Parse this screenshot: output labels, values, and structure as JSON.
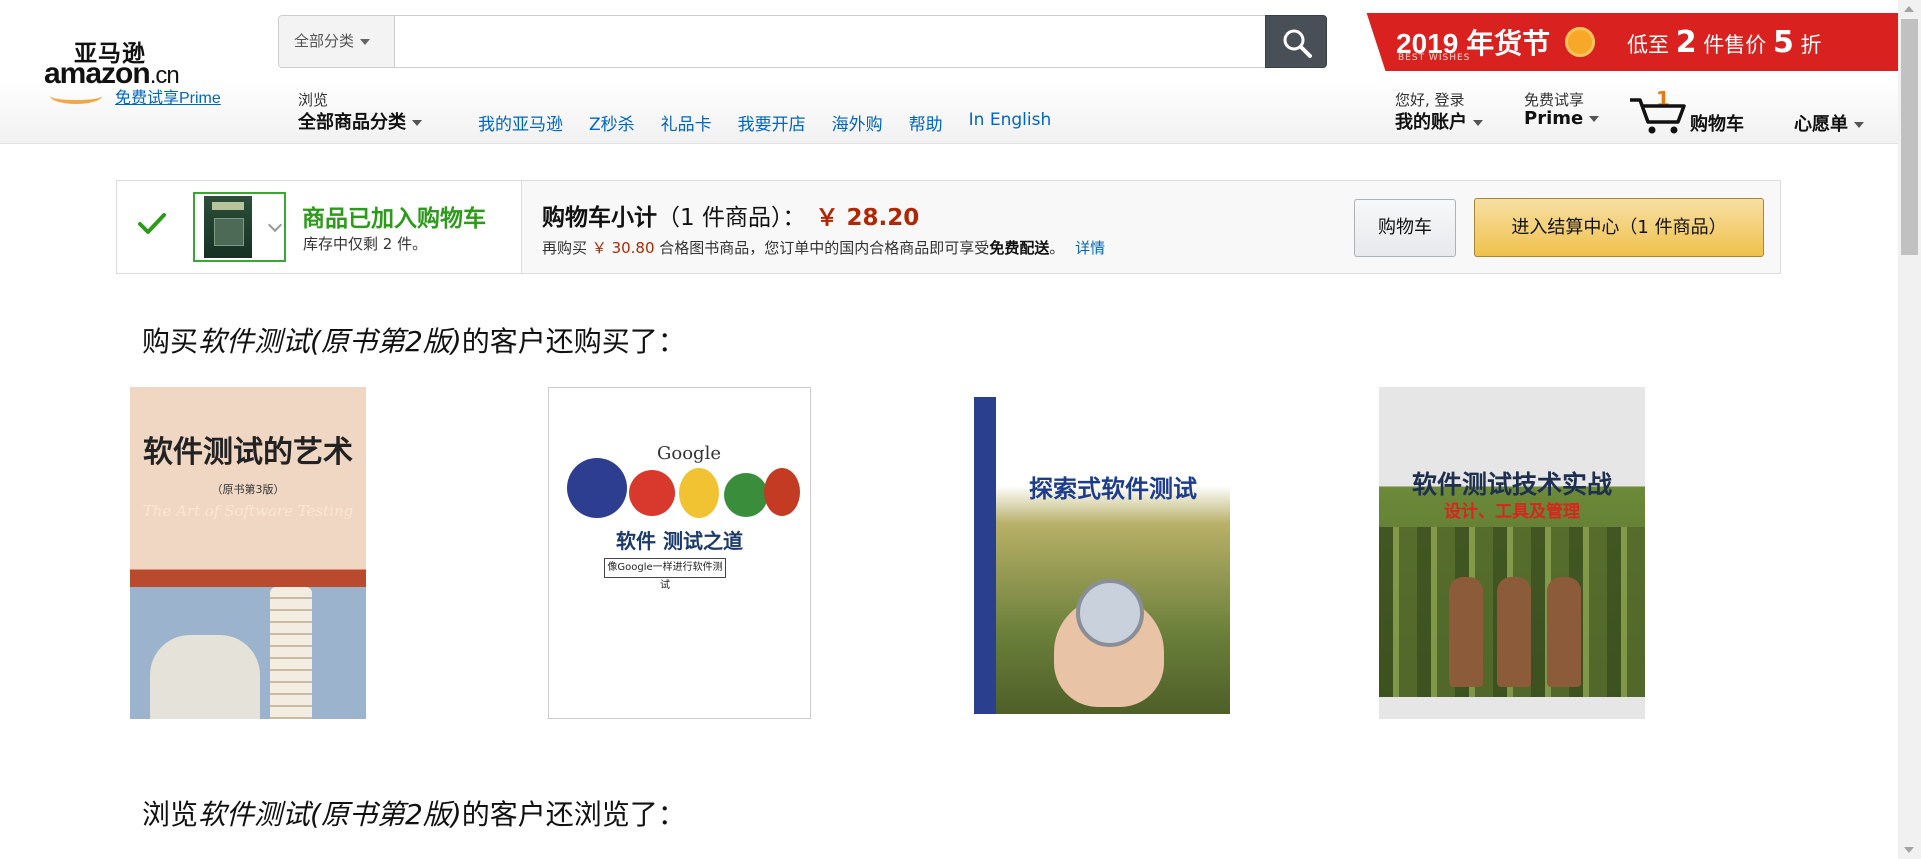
{
  "header": {
    "logo": {
      "cn_name": "亚马逊",
      "brand": "amazon",
      "tld": ".cn",
      "prime_link": "免费试享Prime"
    },
    "search": {
      "category": "全部分类",
      "placeholder": "",
      "value": ""
    },
    "promo": {
      "year_text": "2019 年货节",
      "sub_text": "BEST WISHES",
      "offer_prefix": "低至",
      "offer_n1": "2",
      "offer_mid": "件售价",
      "offer_n2": "5",
      "offer_suffix": "折"
    },
    "browse": {
      "small": "浏览",
      "big": "全部商品分类"
    },
    "nav_links": [
      "我的亚马逊",
      "Z秒杀",
      "礼品卡",
      "我要开店",
      "海外购",
      "帮助",
      "In English"
    ],
    "account": {
      "small": "您好, 登录",
      "big": "我的账户"
    },
    "prime": {
      "small": "免费试享",
      "big": "Prime"
    },
    "cart": {
      "count": "1",
      "label": "购物车"
    },
    "wishlist": "心愿单"
  },
  "added_to_cart": {
    "title": "商品已加入购物车",
    "stock": "库存中仅剩 2 件。",
    "subtotal_label": "购物车小计",
    "subtotal_items": "（1 件商品）：",
    "subtotal_price": "￥ 28.20",
    "note_prefix": "再购买",
    "note_amount": "￥ 30.80",
    "note_middle": "合格图书商品，您订单中的国内合格商品即可享受",
    "note_bold": "免费配送",
    "note_end": "。",
    "note_link": "详情",
    "cart_button": "购物车",
    "checkout_button": "进入结算中心（1 件商品）"
  },
  "recommendations": {
    "bought_prefix": "购买",
    "bought_title": "软件测试(原书第2版)",
    "bought_suffix": "的客户还购买了：",
    "books": [
      {
        "title": "软件测试的艺术",
        "edition": "（原书第3版）",
        "english": "The Art of Software Testing"
      },
      {
        "brand": "Google",
        "title": "软件  测试之道",
        "subtitle": "像Google一样进行软件测试"
      },
      {
        "title": "探索式软件测试"
      },
      {
        "title": "软件测试技术实战",
        "subtitle": "设计、工具及管理"
      }
    ],
    "viewed_prefix": "浏览",
    "viewed_title": "软件测试(原书第2版)",
    "viewed_suffix": "的客户还浏览了："
  }
}
